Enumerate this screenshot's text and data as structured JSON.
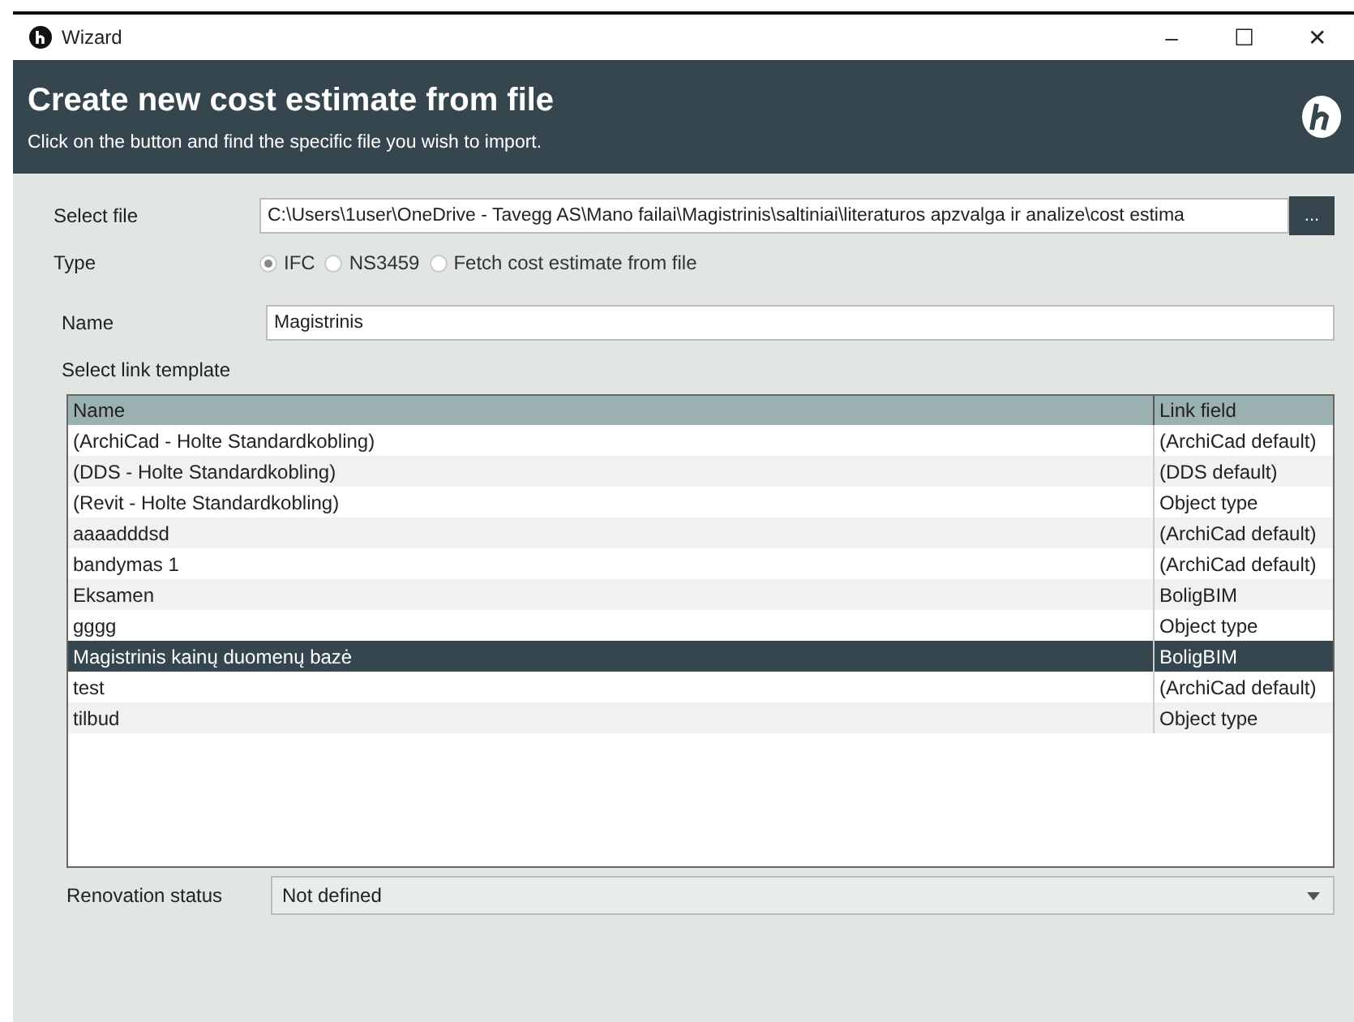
{
  "window": {
    "title": "Wizard",
    "controls": [
      "–",
      "☐",
      "✕"
    ]
  },
  "header": {
    "title": "Create new cost estimate from file",
    "subtitle": "Click on the button and find the specific file you wish to import."
  },
  "select_file": {
    "label": "Select file",
    "value": "C:\\Users\\1user\\OneDrive - Tavegg AS\\Mano failai\\Magistrinis\\saltiniai\\literaturos apzvalga ir analize\\cost estima",
    "button": "..."
  },
  "type": {
    "label": "Type",
    "options": [
      {
        "label": "IFC",
        "selected": true
      },
      {
        "label": "NS3459",
        "selected": false
      },
      {
        "label": "Fetch cost estimate from file",
        "selected": false
      }
    ]
  },
  "name": {
    "label": "Name",
    "value": "Magistrinis"
  },
  "link_template": {
    "label": "Select link template",
    "columns": [
      "Name",
      "Link field"
    ],
    "rows": [
      {
        "name": "(ArchiCad - Holte Standardkobling)",
        "link_field": "(ArchiCad default)",
        "selected": false
      },
      {
        "name": "(DDS - Holte Standardkobling)",
        "link_field": "(DDS default)",
        "selected": false
      },
      {
        "name": "(Revit - Holte Standardkobling)",
        "link_field": "Object type",
        "selected": false
      },
      {
        "name": "aaaadddsd",
        "link_field": "(ArchiCad default)",
        "selected": false
      },
      {
        "name": "bandymas 1",
        "link_field": "(ArchiCad default)",
        "selected": false
      },
      {
        "name": "Eksamen",
        "link_field": "BoligBIM",
        "selected": false
      },
      {
        "name": "gggg",
        "link_field": "Object type",
        "selected": false
      },
      {
        "name": "Magistrinis kainų duomenų bazė",
        "link_field": "BoligBIM",
        "selected": true
      },
      {
        "name": "test",
        "link_field": "(ArchiCad default)",
        "selected": false
      },
      {
        "name": "tilbud",
        "link_field": "Object type",
        "selected": false
      }
    ]
  },
  "renovation_status": {
    "label": "Renovation status",
    "value": "Not defined"
  }
}
